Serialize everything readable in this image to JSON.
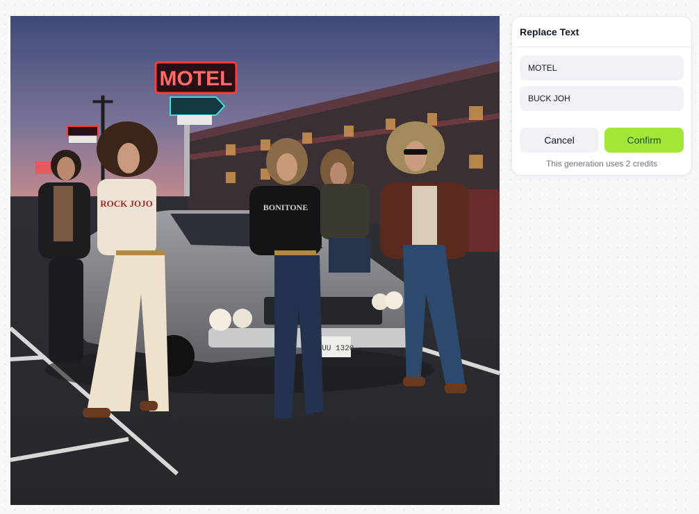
{
  "image": {
    "alt_subject": "photo",
    "scene_sign_text": "MOTEL",
    "shirt_text_left": "ROCK JOJO",
    "shirt_text_center": "BONITONE",
    "plate_text": "DUU 1320"
  },
  "panel": {
    "title": "Replace Text",
    "original_text_value": "MOTEL",
    "replacement_text_value": "BUCK JOH",
    "cancel_label": "Cancel",
    "confirm_label": "Confirm",
    "credits_note": "This generation uses 2 credits"
  },
  "colors": {
    "confirm_bg": "#a3e635",
    "neon_red": "#ff3b3b",
    "neon_teal": "#3de0e0"
  }
}
